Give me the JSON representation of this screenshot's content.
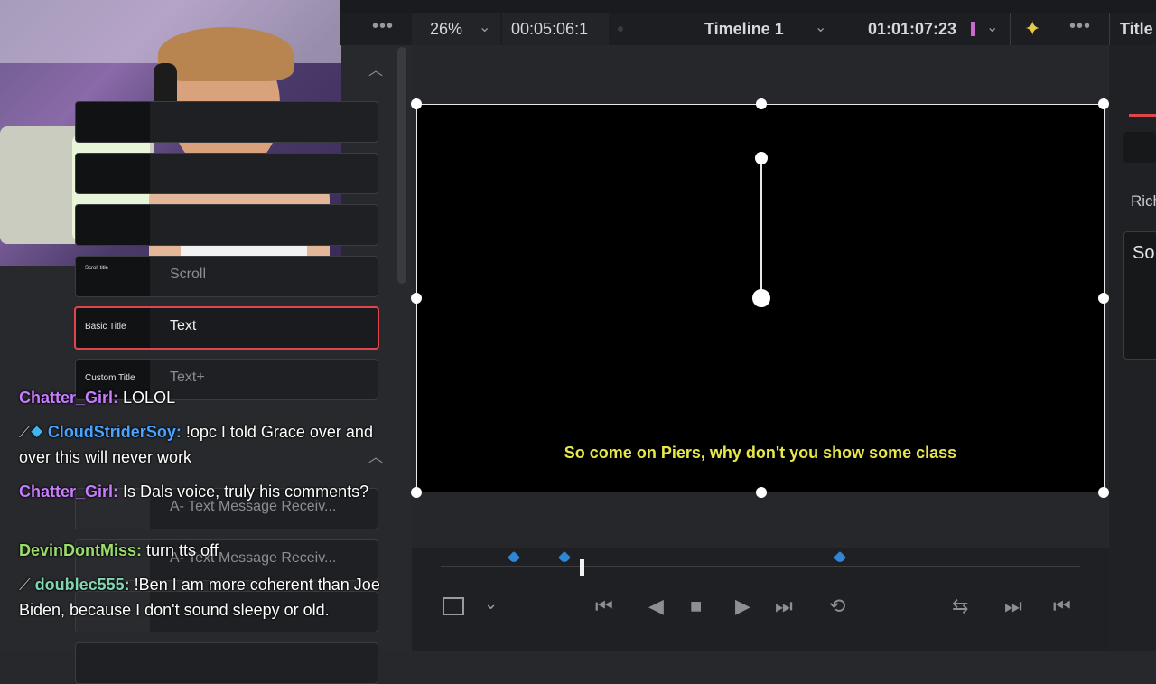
{
  "toolbar": {
    "zoom": "26%",
    "timecode_left": "00:05:06:1",
    "timeline_name": "Timeline 1",
    "timecode_right": "01:01:07:23",
    "inspector_title": "Title"
  },
  "titles_panel": {
    "items": [
      {
        "thumb": "",
        "label": ""
      },
      {
        "thumb": "",
        "label": ""
      },
      {
        "thumb": "",
        "label": ""
      },
      {
        "thumb": "Scroll title",
        "label": "Scroll"
      },
      {
        "thumb": "Basic Title",
        "label": "Text"
      },
      {
        "thumb": "Custom Title",
        "label": "Text+"
      },
      {
        "thumb": "",
        "label": "A- Text Message Receiv..."
      },
      {
        "thumb": "",
        "label": "A- Text Message Receiv..."
      }
    ]
  },
  "viewer": {
    "subtitle": "So come on Piers, why don't you show some class"
  },
  "inspector": {
    "rich_label": "Rich",
    "text_preview": "So"
  },
  "chat": [
    {
      "user": "Chatter_Girl:",
      "message": "LOLOL"
    },
    {
      "user": "CloudStriderSoy:",
      "message": "!opc I told Grace over and over this will never work"
    },
    {
      "user": "Chatter_Girl:",
      "message": "Is Dals voice, truly his comments?"
    },
    {
      "user": "DevinDontMiss:",
      "message": "turn tts off"
    },
    {
      "user": "doublec555:",
      "message": "!Ben I am more coherent than Joe Biden, because I don't sound sleepy or old."
    }
  ],
  "colors": {
    "selected_border": "#e0454a",
    "subtitle": "#e8e84a",
    "marker": "#2f86d6"
  }
}
